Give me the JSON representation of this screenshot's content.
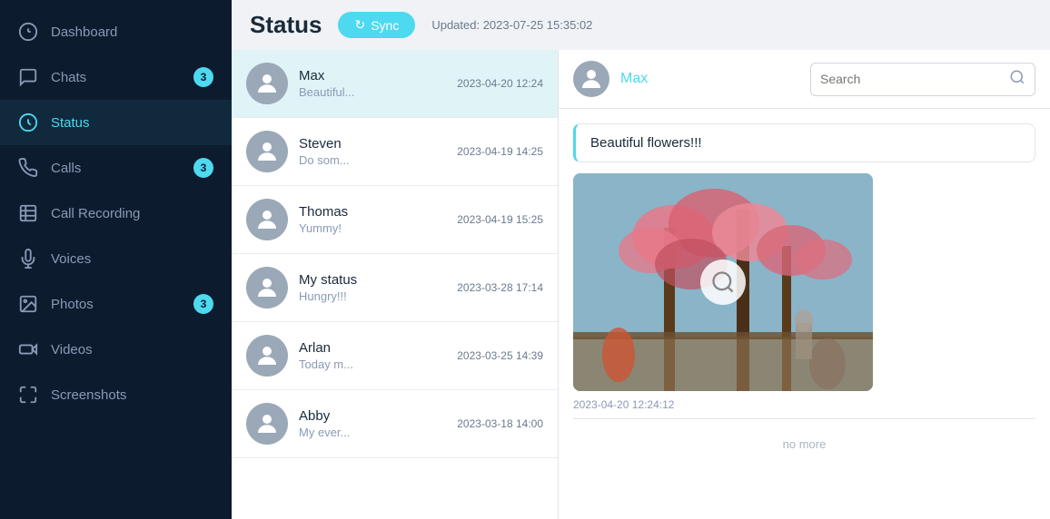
{
  "sidebar": {
    "items": [
      {
        "id": "dashboard",
        "label": "Dashboard",
        "icon": "dashboard-icon",
        "badge": null
      },
      {
        "id": "chats",
        "label": "Chats",
        "icon": "chats-icon",
        "badge": "3"
      },
      {
        "id": "status",
        "label": "Status",
        "icon": "status-icon",
        "badge": null,
        "active": true
      },
      {
        "id": "calls",
        "label": "Calls",
        "icon": "calls-icon",
        "badge": "3"
      },
      {
        "id": "call-recording",
        "label": "Call Recording",
        "icon": "call-recording-icon",
        "badge": null
      },
      {
        "id": "voices",
        "label": "Voices",
        "icon": "voices-icon",
        "badge": null
      },
      {
        "id": "photos",
        "label": "Photos",
        "icon": "photos-icon",
        "badge": "3"
      },
      {
        "id": "videos",
        "label": "Videos",
        "icon": "videos-icon",
        "badge": null
      },
      {
        "id": "screenshots",
        "label": "Screenshots",
        "icon": "screenshots-icon",
        "badge": null
      }
    ]
  },
  "header": {
    "title": "Status",
    "sync_label": "Sync",
    "updated_text": "Updated: 2023-07-25 15:35:02"
  },
  "status_list": {
    "items": [
      {
        "id": 1,
        "name": "Max",
        "preview": "Beautiful...",
        "time": "2023-04-20 12:24",
        "selected": true
      },
      {
        "id": 2,
        "name": "Steven",
        "preview": "Do som...",
        "time": "2023-04-19 14:25",
        "selected": false
      },
      {
        "id": 3,
        "name": "Thomas",
        "preview": "Yummy!",
        "time": "2023-04-19 15:25",
        "selected": false
      },
      {
        "id": 4,
        "name": "My status",
        "preview": "Hungry!!!",
        "time": "2023-03-28 17:14",
        "selected": false
      },
      {
        "id": 5,
        "name": "Arlan",
        "preview": "Today m...",
        "time": "2023-03-25 14:39",
        "selected": false
      },
      {
        "id": 6,
        "name": "Abby",
        "preview": "My ever...",
        "time": "2023-03-18 14:00",
        "selected": false
      }
    ]
  },
  "detail": {
    "contact_name": "Max",
    "search_placeholder": "Search",
    "message_text": "Beautiful flowers!!!",
    "image_timestamp": "2023-04-20 12:24:12",
    "no_more_label": "no more"
  }
}
